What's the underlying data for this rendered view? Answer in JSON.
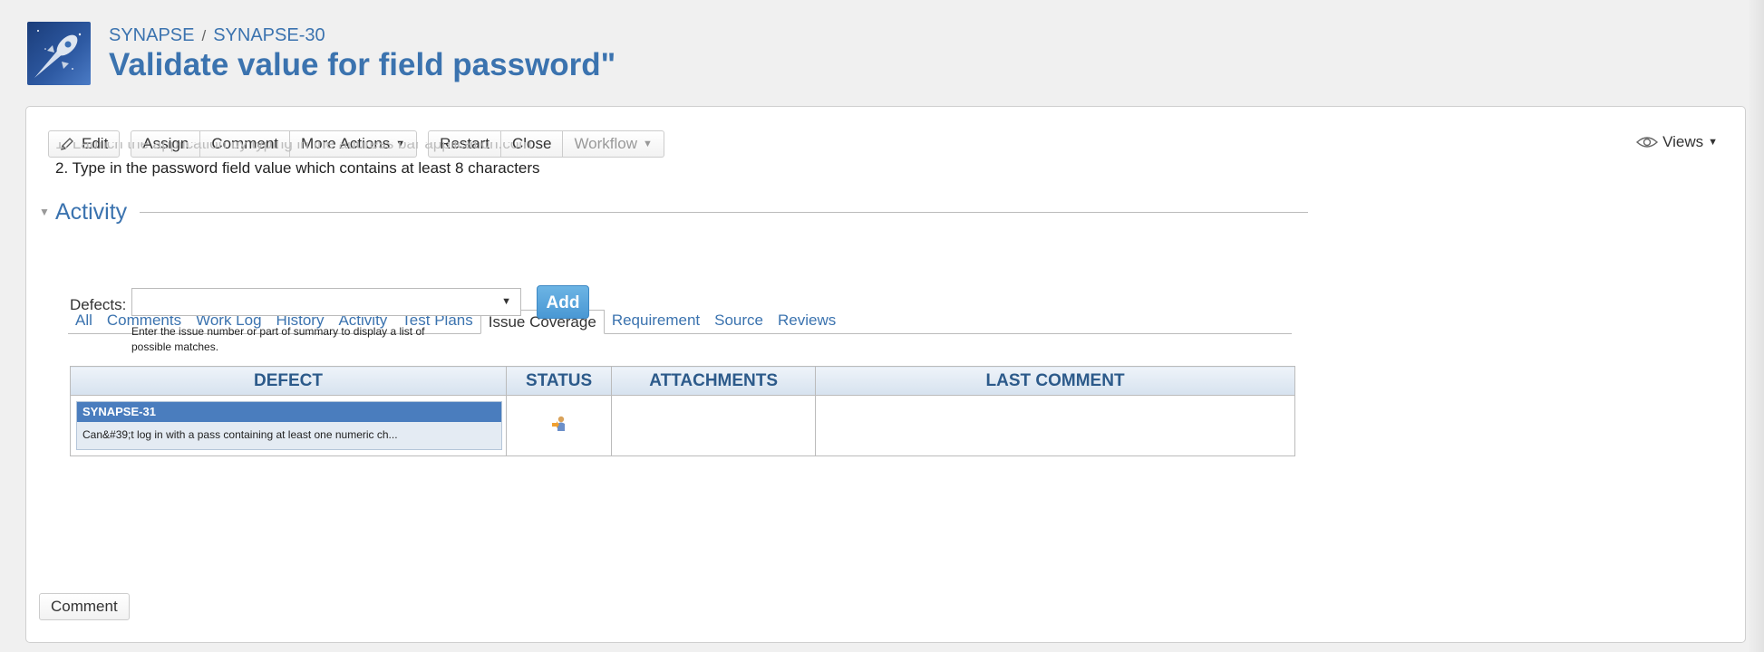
{
  "breadcrumb": {
    "project": "SYNAPSE",
    "separator": "/",
    "issue_key": "SYNAPSE-30"
  },
  "issue": {
    "title": "Validate value for field password\""
  },
  "toolbar": {
    "edit": "Edit",
    "assign": "Assign",
    "comment": "Comment",
    "more_actions": "More Actions",
    "restart": "Restart",
    "close": "Close",
    "workflow": "Workflow",
    "views": "Views"
  },
  "steps": {
    "step1": "1. Launch the application by typing in the address bar application.com",
    "step2": "2. Type in the password field value which contains at least 8 characters"
  },
  "activity": {
    "heading": "Activity",
    "tabs": [
      {
        "label": "All",
        "active": false
      },
      {
        "label": "Comments",
        "active": false
      },
      {
        "label": "Work Log",
        "active": false
      },
      {
        "label": "History",
        "active": false
      },
      {
        "label": "Activity",
        "active": false
      },
      {
        "label": "Test Plans",
        "active": false
      },
      {
        "label": "Issue Coverage",
        "active": true
      },
      {
        "label": "Requirement",
        "active": false
      },
      {
        "label": "Source",
        "active": false
      },
      {
        "label": "Reviews",
        "active": false
      }
    ]
  },
  "defects": {
    "label": "Defects:",
    "select_value": "",
    "add_label": "Add",
    "hint_line1": "Enter the issue number or part of summary to display a list of",
    "hint_line2": "possible matches."
  },
  "table": {
    "headers": {
      "defect": "DEFECT",
      "status": "STATUS",
      "attachments": "ATTACHMENTS",
      "last_comment": "LAST COMMENT"
    },
    "rows": [
      {
        "key": "SYNAPSE-31",
        "summary": "Can&#39;t log in with a pass containing at least one numeric ch...",
        "status_icon": "in-progress-icon",
        "attachments": "",
        "last_comment": ""
      }
    ]
  },
  "footer": {
    "comment_button": "Comment"
  },
  "colors": {
    "link_blue": "#3b73af",
    "add_button": "#4a98d4",
    "defect_key_bg": "#4a7dbe",
    "header_text": "#2c5a8a"
  }
}
